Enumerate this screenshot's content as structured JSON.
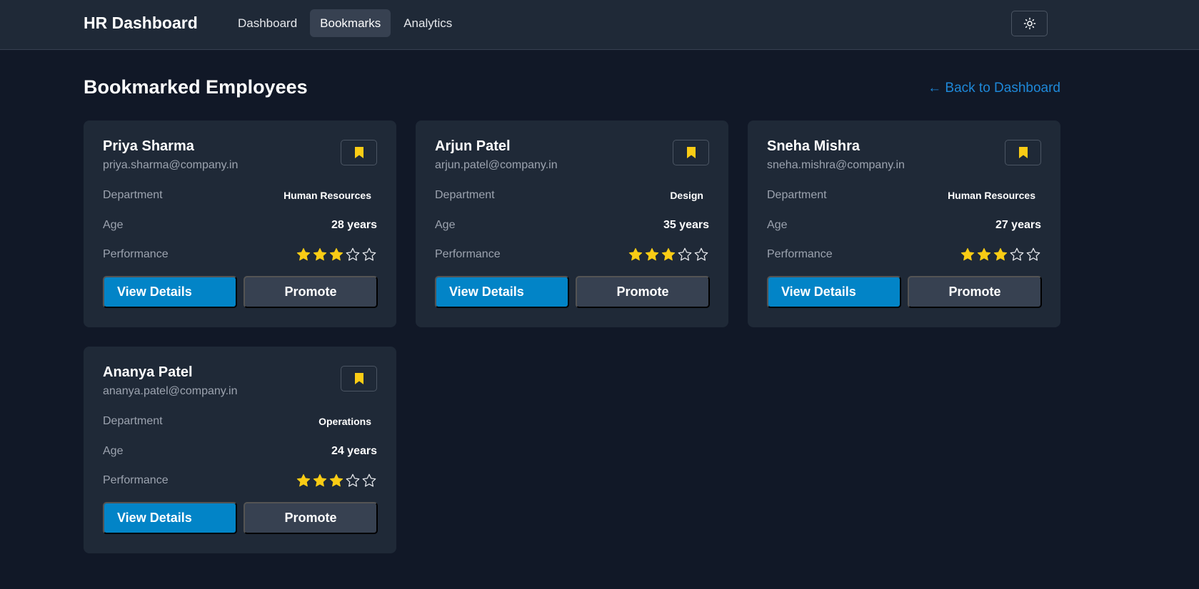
{
  "header": {
    "brand": "HR Dashboard",
    "nav": [
      {
        "label": "Dashboard",
        "active": false
      },
      {
        "label": "Bookmarks",
        "active": true
      },
      {
        "label": "Analytics",
        "active": false
      }
    ],
    "theme_toggle_icon": "sun-icon"
  },
  "main": {
    "title": "Bookmarked Employees",
    "back_link": "← Back to Dashboard"
  },
  "labels": {
    "department": "Department",
    "age": "Age",
    "performance": "Performance",
    "view_details": "View Details",
    "promote": "Promote"
  },
  "employees": [
    {
      "name": "Priya Sharma",
      "email": "priya.sharma@company.in",
      "department": "Human Resources",
      "age": "28 years",
      "rating": 3,
      "rating_max": 5,
      "bookmarked": true
    },
    {
      "name": "Arjun Patel",
      "email": "arjun.patel@company.in",
      "department": "Design",
      "age": "35 years",
      "rating": 3,
      "rating_max": 5,
      "bookmarked": true
    },
    {
      "name": "Sneha Mishra",
      "email": "sneha.mishra@company.in",
      "department": "Human Resources",
      "age": "27 years",
      "rating": 3,
      "rating_max": 5,
      "bookmarked": true
    },
    {
      "name": "Ananya Patel",
      "email": "ananya.patel@company.in",
      "department": "Operations",
      "age": "24 years",
      "rating": 3,
      "rating_max": 5,
      "bookmarked": true
    }
  ],
  "colors": {
    "background": "#111827",
    "card": "#1f2937",
    "primary_button": "#0284c7",
    "secondary_button": "#374151",
    "link": "#1e88d8",
    "star_filled": "#facc15",
    "bookmark": "#facc15"
  }
}
